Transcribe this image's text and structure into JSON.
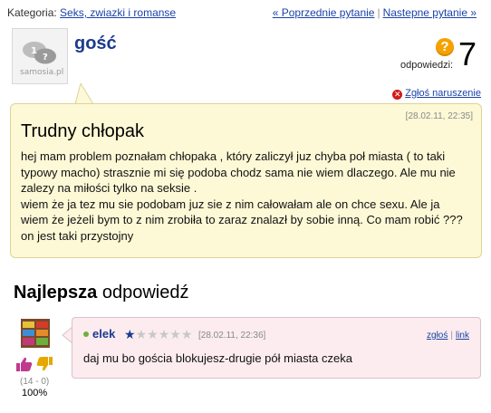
{
  "topbar": {
    "category_label": "Kategoria:",
    "category_link": "Seks, zwiazki i romanse",
    "prev_link": "« Poprzednie pytanie",
    "next_link": "Nastepne pytanie »"
  },
  "question": {
    "author": "gość",
    "avatar_text": "samosia.pl",
    "answers_label": "odpowiedzi:",
    "answers_count": "7",
    "report_label": "Zgłoś naruszenie",
    "date": "[28.02.11, 22:35]",
    "title": "Trudny chłopak",
    "body_lines": [
      "hej mam problem poznałam chłopaka , który zaliczył juz chyba poł miasta ( to taki typowy macho) strasznie mi się podoba chodz sama nie wiem dlaczego. Ale mu nie zalezy na miłości tylko na seksie .",
      "wiem że ja tez mu sie podobam juz sie z nim całowałam ale on chce sexu. Ale ja wiem że jeżeli bym to z nim zrobiła to zaraz znalazł by sobie inną. Co mam robić ???on jest taki przystojny"
    ]
  },
  "best_answer": {
    "heading_bold": "Najlepsza",
    "heading_rest": " odpowiedź",
    "author": "elek",
    "rating": 1,
    "rating_max": 6,
    "date": "[28.02.11, 22:36]",
    "report_link": "zgłoś",
    "link_label": "link",
    "text": "daj mu bo gościa blokujesz-drugie pół miasta czeka",
    "votes": "(14 - 0)",
    "percent": "100%"
  }
}
